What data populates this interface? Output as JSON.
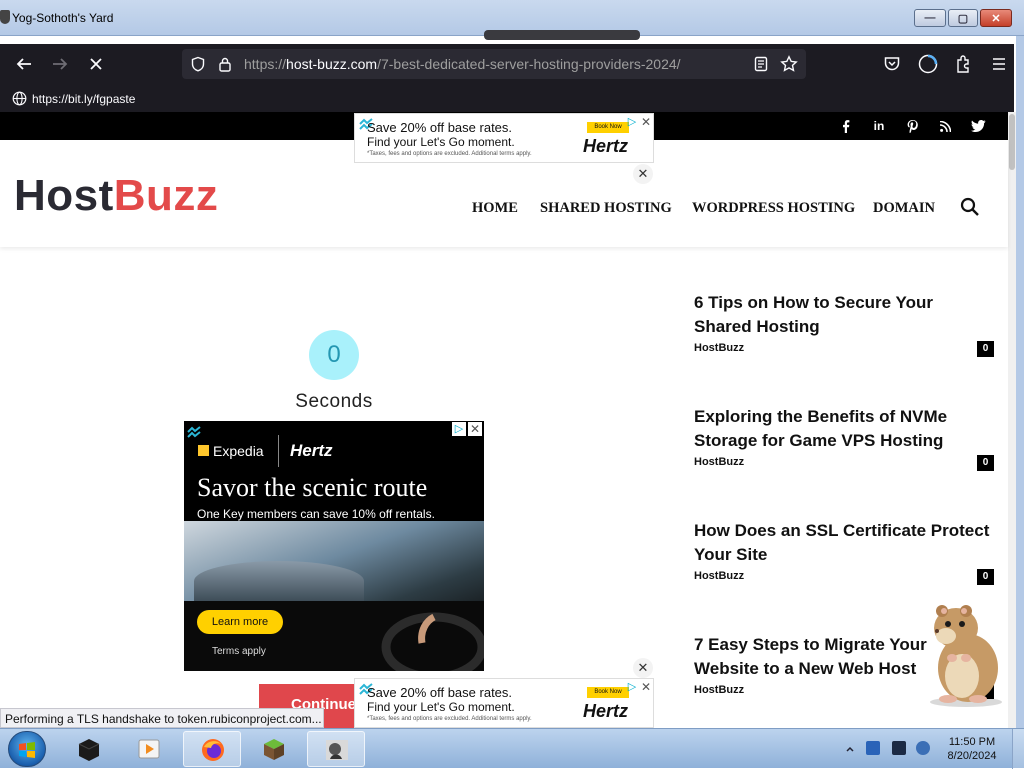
{
  "window": {
    "title": "Yog-Sothoth's Yard",
    "min_glyph": "—",
    "max_glyph": "▢",
    "close_glyph": "✕"
  },
  "browser": {
    "url_prefix": "https://",
    "url_host": "host-buzz.com",
    "url_path": "/7-best-dedicated-server-hosting-providers-2024/",
    "bookmark_label": "https://bit.ly/fgpaste",
    "status_text": "Performing a TLS handshake to token.rubiconproject.com..."
  },
  "site": {
    "logo_part1": "Host",
    "logo_part2": "Buzz",
    "menu": [
      "HOME",
      "SHARED HOSTING",
      "WORDPRESS HOSTING",
      "DOMAIN"
    ],
    "social": [
      "f",
      "in",
      "p",
      "rss",
      "twitter"
    ]
  },
  "ad_banner": {
    "line1": "Save 20% off base rates.",
    "line2": "Find your Let's Go moment.",
    "line3": "*Taxes, fees and options are excluded. Additional terms apply.",
    "book_now": "Book Now",
    "brand": "Hertz",
    "close_glyph": "✕"
  },
  "big_ad": {
    "brand1": "Expedia",
    "brand2": "Hertz",
    "headline": "Savor the scenic route",
    "subtext": "One Key members can save 10% off rentals.",
    "cta": "Learn more",
    "terms": "Terms apply"
  },
  "countdown": {
    "value": "0",
    "label": "Seconds",
    "continue_label": "Continue"
  },
  "sidebar": {
    "posts": [
      {
        "title": "6 Tips on How to Secure Your Shared Hosting",
        "author": "HostBuzz",
        "comments": "0"
      },
      {
        "title": "Exploring the Benefits of NVMe Storage for Game VPS Hosting",
        "author": "HostBuzz",
        "comments": "0"
      },
      {
        "title": "How Does an SSL Certificate Protect Your Site",
        "author": "HostBuzz",
        "comments": "0"
      },
      {
        "title": "7 Easy Steps to Migrate Your Website to a New Web Host",
        "author": "HostBuzz",
        "comments": "0"
      }
    ]
  },
  "taskbar": {
    "time": "11:50 PM",
    "date": "8/20/2024"
  },
  "colors": {
    "brand_red": "#e34a4a",
    "counter_bg": "#a9f1fb",
    "continue_bg": "#e0474c",
    "firefox_chrome": "#1c1b22"
  }
}
